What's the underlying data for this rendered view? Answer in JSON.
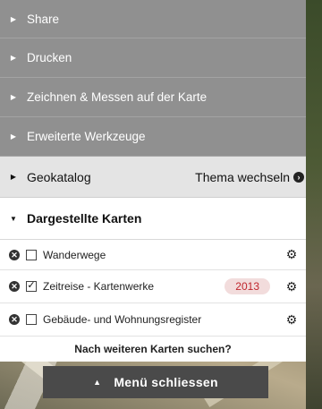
{
  "menu": {
    "items": [
      {
        "label": "Share"
      },
      {
        "label": "Drucken"
      },
      {
        "label": "Zeichnen & Messen auf der Karte"
      },
      {
        "label": "Erweiterte Werkzeuge"
      }
    ],
    "geokatalog": {
      "label": "Geokatalog",
      "theme_label": "Thema wechseln"
    },
    "dargestellte": {
      "label": "Dargestellte Karten"
    }
  },
  "layers": [
    {
      "name": "Wanderwege",
      "checked": false
    },
    {
      "name": "Zeitreise - Kartenwerke",
      "checked": true,
      "year": "2013"
    },
    {
      "name": "Gebäude- und Wohnungsregister",
      "checked": false
    }
  ],
  "search_link": "Nach weiteren Karten suchen?",
  "close_button": "Menü schliessen",
  "colors": {
    "menu_gray": "#909090",
    "year_badge_text": "#c0262d",
    "close_bg": "#4a4a4a"
  }
}
